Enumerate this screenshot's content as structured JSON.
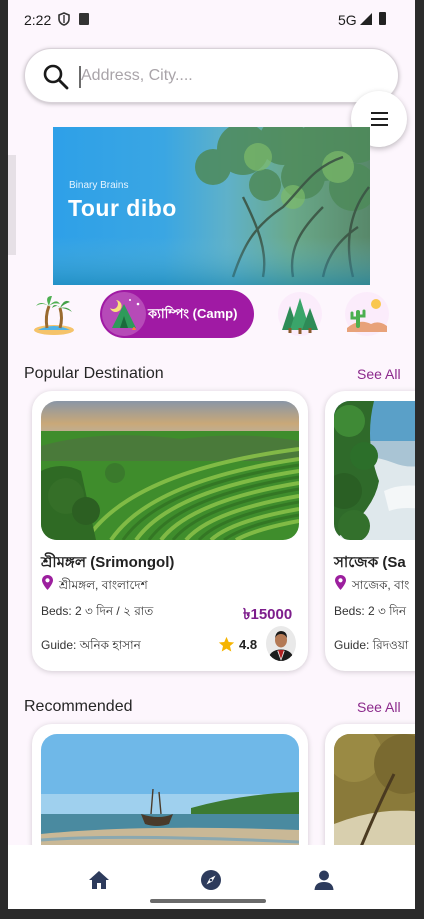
{
  "status_bar": {
    "time": "2:22",
    "network": "5G"
  },
  "search": {
    "placeholder": "Address, City...."
  },
  "banner": {
    "tag": "Binary Brains",
    "title": "Tour dibo"
  },
  "categories": [
    {
      "icon": "beach-icon",
      "label": ""
    },
    {
      "icon": "camping-icon",
      "label": "ক্যাম্পিং (Camp)",
      "selected": true
    },
    {
      "icon": "forest-icon",
      "label": ""
    },
    {
      "icon": "desert-icon",
      "label": ""
    }
  ],
  "popular": {
    "title": "Popular Destination",
    "see_all": "See All",
    "cards": [
      {
        "name": "শ্রীমঙ্গল (Srimongol)",
        "location": "শ্রীমঙ্গল, বাংলাদেশ",
        "beds": "Beds: 2  ৩ দিন / ২ রাত",
        "price": "৳15000",
        "guide": "Guide: অনিক হাসান",
        "rating": "4.8"
      },
      {
        "name": "সাজেক (Sa",
        "location": "সাজেক, বাং",
        "beds": "Beds: 2  ৩ দিন",
        "guide": "Guide: রিদওয়া"
      }
    ]
  },
  "recommended": {
    "title": "Recommended",
    "see_all": "See All"
  },
  "colors": {
    "accent": "#a01aa4",
    "price": "#7d1d8c",
    "nav": "#2d3b5c",
    "background": "#fdf6fd"
  }
}
